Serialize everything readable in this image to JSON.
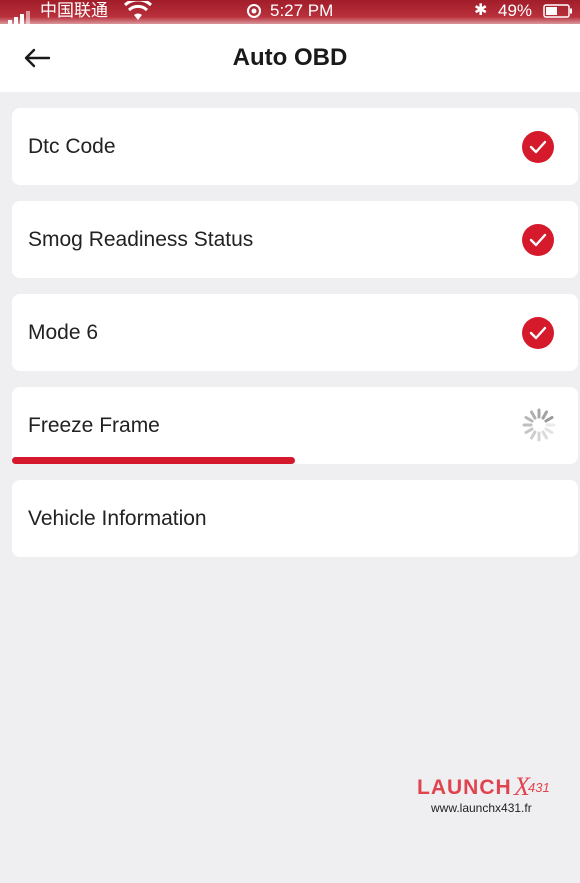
{
  "status_bar": {
    "carrier": "中国联通",
    "time": "5:27 PM",
    "battery": "49%",
    "icons": [
      "signal-icon",
      "wifi-icon",
      "location-icon",
      "bluetooth-icon",
      "battery-icon"
    ]
  },
  "header": {
    "back_icon": "arrow-left-icon",
    "title": "Auto OBD"
  },
  "items": [
    {
      "label": "Dtc Code",
      "status": "done"
    },
    {
      "label": "Smog Readiness Status",
      "status": "done"
    },
    {
      "label": "Mode 6",
      "status": "done"
    },
    {
      "label": "Freeze Frame",
      "status": "loading",
      "progress_fraction": 0.5
    },
    {
      "label": "Vehicle Information",
      "status": "pending"
    }
  ],
  "watermark": {
    "brand": "LAUNCH",
    "brand_x": "X",
    "brand_num": "431",
    "url": "www.launchx431.fr"
  },
  "colors": {
    "accent": "#d51a2c",
    "background": "#efeff1",
    "card": "#ffffff",
    "status_bar": "#b0232f"
  }
}
